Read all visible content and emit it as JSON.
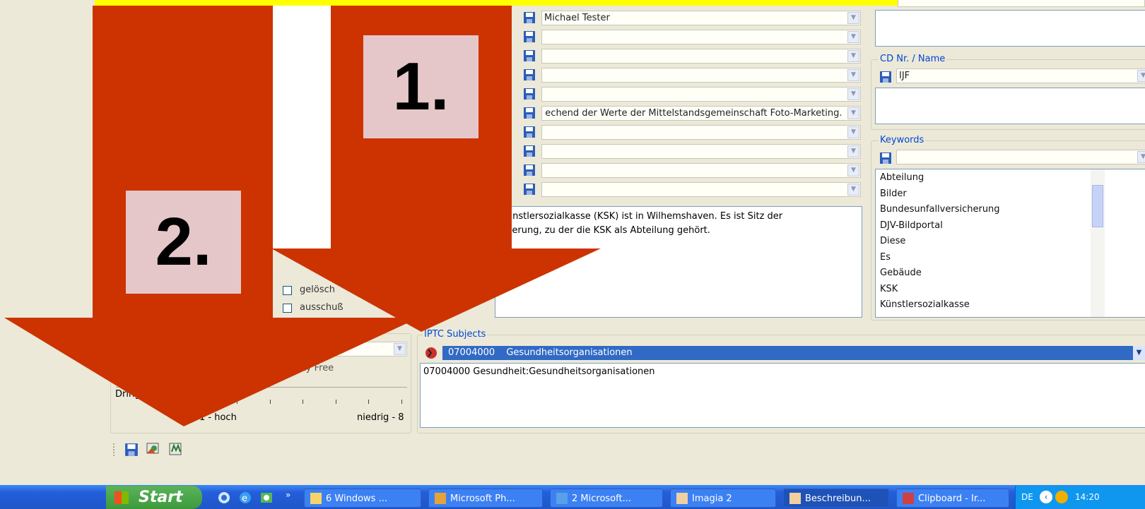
{
  "fields": {
    "photographer": "Michael Tester",
    "empty_rows": [
      "",
      "",
      "",
      ""
    ],
    "copyright": " echend der Werte der Mittelstandsgemeinschaft Foto-Marketing.",
    "more_rows": [
      "",
      "",
      "",
      ""
    ],
    "description_line1": "Künstlersozialkasse (KSK)  ist in Wilhemshaven. Es ist Sitz der",
    "description_line2": "cherung, zu der die KSK als Abteilung gehört."
  },
  "cd": {
    "label": "CD Nr. / Name",
    "value": "IJF"
  },
  "keywords": {
    "label": "Keywords",
    "items": [
      "Abteilung",
      "Bilder",
      "Bundesunfallversicherung",
      "DJV-Bildportal",
      "Diese",
      "Es",
      "Gebäude",
      "KSK",
      "Künstlersozialkasse"
    ]
  },
  "flags": {
    "item1": "gelösch",
    "item2": "ausschuß"
  },
  "license": {
    "value": "Royalty Free"
  },
  "urgency": {
    "label": "Dring",
    "low": "1 - hoch",
    "high": "niedrig - 8"
  },
  "iptc": {
    "label": "IPTC Subjects",
    "selected_code": "07004000",
    "selected_name": "Gesundheitsorganisationen",
    "list_item": "07004000 Gesundheit:Gesundheitsorganisationen"
  },
  "callouts": {
    "one": "1.",
    "two": "2."
  },
  "colors": {
    "arrow": "#cc3300",
    "banner": "#ffff00",
    "callout_bg": "#e6c7c9",
    "taskbar": "#245edb",
    "start": "#3c9a3c",
    "iptc_selected": "#316ac5"
  },
  "taskbar": {
    "start": "Start",
    "items": [
      "6 Windows ...",
      "Microsoft Ph...",
      "2 Microsoft...",
      "Imagia 2",
      "Beschreibun...",
      "Clipboard - Ir..."
    ],
    "lang": "DE",
    "time": "14:20"
  }
}
